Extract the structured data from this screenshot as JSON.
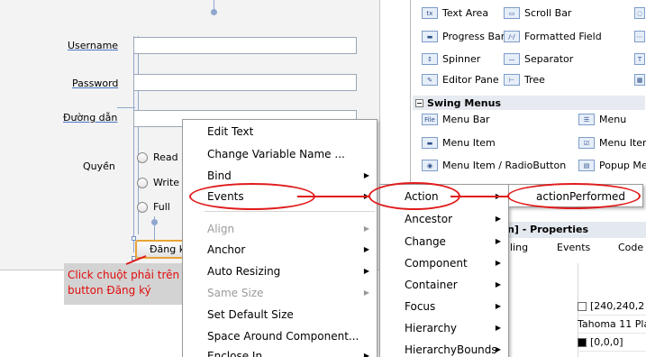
{
  "form": {
    "username_label": "Username",
    "password_label": "Password",
    "path_label": "Đường dẫn",
    "permission_label": "Quyền",
    "radio_read": "Read",
    "radio_write": "Write",
    "radio_full": "Full",
    "register_button": "Đăng ký"
  },
  "annotation": {
    "note_line1": "Click chuột phải trên",
    "note_line2": "button Đăng ký"
  },
  "palette": {
    "items": [
      "Text Area",
      "Scroll Bar",
      "Progress Bar",
      "Formatted Field",
      "Spinner",
      "Separator",
      "Editor Pane",
      "Tree"
    ],
    "swing_menus_header": "Swing Menus",
    "menu_items": [
      "Menu Bar",
      "Menu",
      "Menu Item",
      "Menu Item",
      "Menu Item / RadioButton",
      "Popup Me"
    ]
  },
  "properties": {
    "title": "tton] - Properties",
    "tab_partial": "ling",
    "tab_events": "Events",
    "tab_code": "Code",
    "rows": [
      "[240,240,2",
      "Tahoma 11 Pla",
      "[0,0,0]"
    ],
    "colors": {
      "background": "#ffffff",
      "foreground": "#000000"
    }
  },
  "context_menu": {
    "items": [
      "Edit Text",
      "Change Variable Name ...",
      "Bind",
      "Events",
      "Align",
      "Anchor",
      "Auto Resizing",
      "Same Size",
      "Set Default Size",
      "Space Around Component...",
      "Enclose In"
    ]
  },
  "events_menu": {
    "items": [
      "Action",
      "Ancestor",
      "Change",
      "Component",
      "Container",
      "Focus",
      "Hierarchy",
      "HierarchyBounds"
    ]
  },
  "action_menu": {
    "items": [
      "actionPerformed"
    ]
  },
  "colors": {
    "highlight_ring": "#e01b1b",
    "note_text": "#e10d0d",
    "selected_button_border": "#e8a436"
  }
}
